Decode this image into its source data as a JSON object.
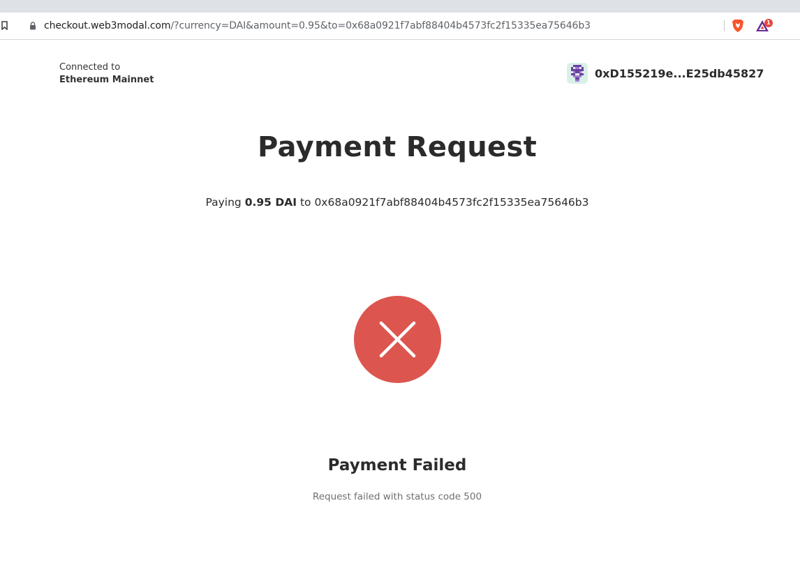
{
  "browser": {
    "url_host": "checkout.web3modal.com",
    "url_path": "/?currency=DAI&amount=0.95&to=0x68a0921f7abf88404b4573fc2f15335ea75646b3",
    "rewards_badge": "1"
  },
  "header": {
    "connected_label": "Connected to",
    "network": "Ethereum Mainnet",
    "wallet_address": "0xD155219e...E25db45827"
  },
  "main": {
    "title": "Payment Request",
    "paying_prefix": "Paying",
    "amount": "0.95 DAI",
    "paying_to": "to",
    "recipient": "0x68a0921f7abf88404b4573fc2f15335ea75646b3"
  },
  "status": {
    "icon": "close-icon",
    "color": "#dc564f",
    "title": "Payment Failed",
    "message": "Request failed with status code 500"
  }
}
